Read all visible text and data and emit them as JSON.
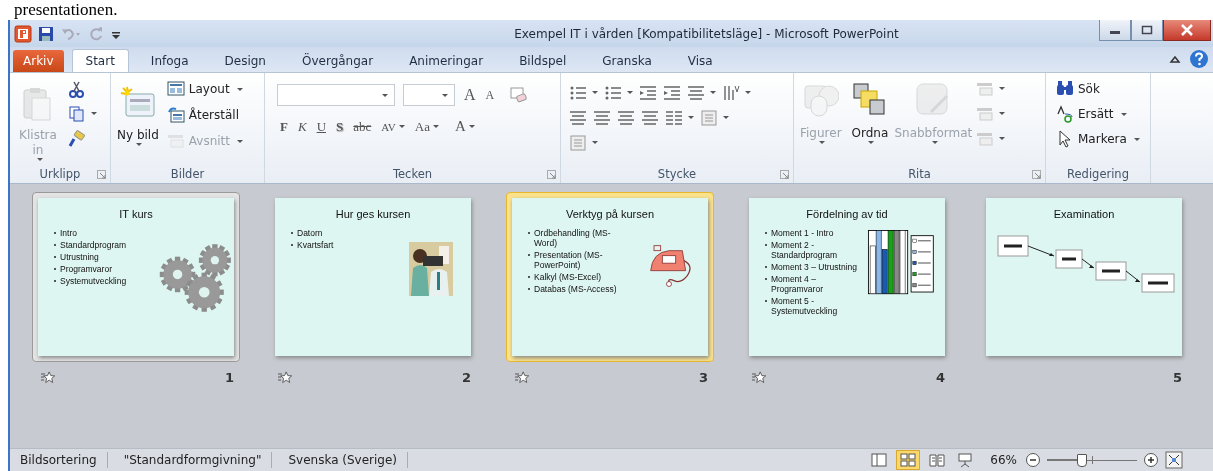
{
  "caption": "presentationen.",
  "window": {
    "title": "Exempel IT i vården [Kompatibilitetsläge]  -  Microsoft PowerPoint"
  },
  "file_tab": "Arkiv",
  "tabs": [
    {
      "label": "Start",
      "selected": true
    },
    {
      "label": "Infoga",
      "selected": false
    },
    {
      "label": "Design",
      "selected": false
    },
    {
      "label": "Övergångar",
      "selected": false
    },
    {
      "label": "Animeringar",
      "selected": false
    },
    {
      "label": "Bildspel",
      "selected": false
    },
    {
      "label": "Granska",
      "selected": false
    },
    {
      "label": "Visa",
      "selected": false
    }
  ],
  "ribbon": [
    {
      "kind": "clipboard",
      "label": "Urklipp",
      "launcher": true,
      "items": [
        {
          "label": "Klistra in",
          "disabled": true,
          "dropdown": true
        }
      ]
    },
    {
      "kind": "slides",
      "label": "Bilder",
      "launcher": false,
      "items": [
        {
          "label": "Ny bild",
          "disabled": false,
          "dropdown": true
        },
        {
          "label": "Layout",
          "disabled": false,
          "dropdown": true
        },
        {
          "label": "Återställ",
          "disabled": false,
          "dropdown": false
        },
        {
          "label": "Avsnitt",
          "disabled": true,
          "dropdown": true
        }
      ]
    },
    {
      "kind": "font",
      "label": "Tecken",
      "launcher": true,
      "items": [
        {
          "label": "A",
          "kind": "grow"
        },
        {
          "label": "A",
          "kind": "shrink"
        },
        {
          "label": "F",
          "kind": "bold"
        },
        {
          "label": "K",
          "kind": "italic"
        },
        {
          "label": "U",
          "kind": "underline"
        },
        {
          "label": "S",
          "kind": "shadow"
        },
        {
          "label": "abc",
          "kind": "strike"
        },
        {
          "label": "AV",
          "kind": "spacing"
        },
        {
          "label": "Aa",
          "kind": "case"
        },
        {
          "label": "A",
          "kind": "color"
        }
      ]
    },
    {
      "kind": "paragraph",
      "label": "Stycke",
      "launcher": true
    },
    {
      "kind": "drawing",
      "label": "Rita",
      "launcher": true,
      "items": [
        {
          "label": "Figurer",
          "disabled": true,
          "dropdown": true
        },
        {
          "label": "Ordna",
          "disabled": false,
          "dropdown": true
        },
        {
          "label": "Snabbformat",
          "disabled": true,
          "dropdown": true
        }
      ]
    },
    {
      "kind": "editing",
      "label": "Redigering",
      "launcher": false,
      "items": [
        {
          "label": "Sök",
          "disabled": false,
          "dropdown": false
        },
        {
          "label": "Ersätt",
          "disabled": false,
          "dropdown": true
        },
        {
          "label": "Markera",
          "disabled": false,
          "dropdown": true
        }
      ]
    }
  ],
  "slides": [
    {
      "kind": "gears",
      "title": "IT kurs",
      "bullets": [
        "Intro",
        "Standardprogram",
        "Utrustning",
        "Programvaror",
        "Systemutveckling"
      ],
      "number": "1",
      "selected": false,
      "hovered": true,
      "transition": true
    },
    {
      "kind": "clipart",
      "title": "Hur ges kursen",
      "bullets": [
        "Datorn",
        "Kvartsfart"
      ],
      "number": "2",
      "selected": false,
      "hovered": false,
      "transition": true
    },
    {
      "kind": "iron",
      "title": "Verktyg på kursen",
      "bullets": [
        "Ordbehandling (MS-Word)",
        "Presentation (MS-PowerPoint)",
        "Kalkyl (MS-Excel)",
        "Databas (MS-Access)"
      ],
      "number": "3",
      "selected": true,
      "hovered": false,
      "transition": true
    },
    {
      "kind": "chart",
      "title": "Fördelning av tid",
      "bullets": [
        "Moment 1 - Intro",
        "Moment 2 - Standardprogram",
        "Moment 3 – Utrustning",
        "Moment 4 – Programvaror",
        "Moment 5 - Systemutveckling"
      ],
      "number": "4",
      "selected": false,
      "hovered": false,
      "transition": true
    },
    {
      "kind": "flow",
      "title": "Examination",
      "number": "5",
      "selected": false,
      "hovered": false,
      "transition": false
    }
  ],
  "status_bar": {
    "items": [
      "Bildsortering",
      "\"Standardformgivning\"",
      "Svenska (Sverige)"
    ],
    "views": [
      {
        "selected": false
      },
      {
        "selected": true
      },
      {
        "selected": false
      },
      {
        "selected": false
      }
    ],
    "zoom": "66%",
    "zoom_slider": {
      "level": 0.38
    }
  }
}
